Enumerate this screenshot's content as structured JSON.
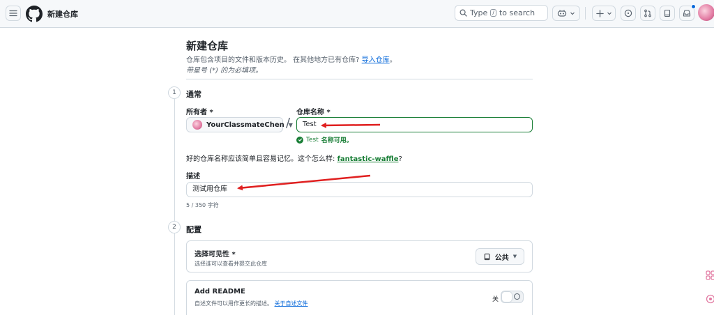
{
  "header": {
    "title": "新建仓库",
    "search_prefix": "Type",
    "search_key": "/",
    "search_suffix": "to search"
  },
  "page": {
    "title": "新建仓库",
    "subtitle_text": "仓库包含项目的文件和版本历史。 在其他地方已有仓库?",
    "import_link": "导入仓库",
    "subtitle_end": "。",
    "required_note": "带星号 (*) 的为必填项。"
  },
  "step1": {
    "number": "1",
    "title": "通常",
    "owner_label": "所有者 *",
    "owner_value": "YourClassmateChen",
    "name_label": "仓库名称 *",
    "name_value": "Test",
    "slash": "/",
    "available_name": "Test",
    "available_text": "名称可用。",
    "suggest_text": "好的仓库名称应该简单且容易记忆。这个怎么样:",
    "suggest_name": "fantastic-waffle",
    "suggest_end": "?",
    "desc_label": "描述",
    "desc_value": "测试用仓库",
    "char_count": "5 / 350 字符"
  },
  "step2": {
    "number": "2",
    "title": "配置",
    "visibility_title": "选择可见性 *",
    "visibility_desc": "选择谁可以查看并提交此仓库",
    "visibility_value": "公共",
    "readme_title": "Add README",
    "readme_desc": "自述文件可以用作更长的描述。",
    "readme_link": "关于自述文件",
    "toggle_label": "关"
  },
  "colors": {
    "accent": "#0969da",
    "success": "#1a7f37",
    "arrow": "#e02020"
  }
}
